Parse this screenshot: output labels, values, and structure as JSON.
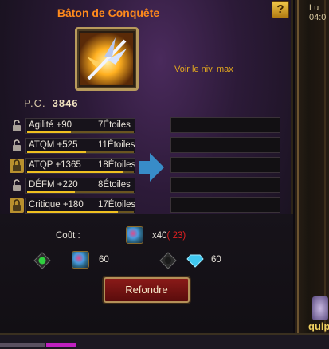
{
  "window": {
    "help_label": "?",
    "title": "Bâton de Conquête",
    "view_max_link": "Voir le niv. max"
  },
  "power": {
    "label": "P.C.",
    "value": "3846"
  },
  "stats": [
    {
      "name": "Agilité +90",
      "stars": "7Étoiles",
      "locked": false,
      "fill": 0.41
    },
    {
      "name": "ATQM +525",
      "stars": "11Étoiles",
      "locked": false,
      "fill": 0.55
    },
    {
      "name": "ATQP +1365",
      "stars": "18Étoiles",
      "locked": true,
      "fill": 0.9
    },
    {
      "name": "DÉFM +220",
      "stars": "8Étoiles",
      "locked": false,
      "fill": 0.45
    },
    {
      "name": "Critique +180",
      "stars": "17Étoiles",
      "locked": true,
      "fill": 0.85
    }
  ],
  "cost": {
    "label": "Coût :",
    "quantity": "x40",
    "have": "( 23)",
    "left_amount": "60",
    "right_amount": "60"
  },
  "reforge_button": "Refondre",
  "side": {
    "top_text": "Lu",
    "top_value": "04:0",
    "bottom_text": "quipe"
  },
  "colors": {
    "title": "#ff8a1c",
    "link": "#e3a81e",
    "star_bar": "#f0c020",
    "button": "#8a1a18"
  }
}
